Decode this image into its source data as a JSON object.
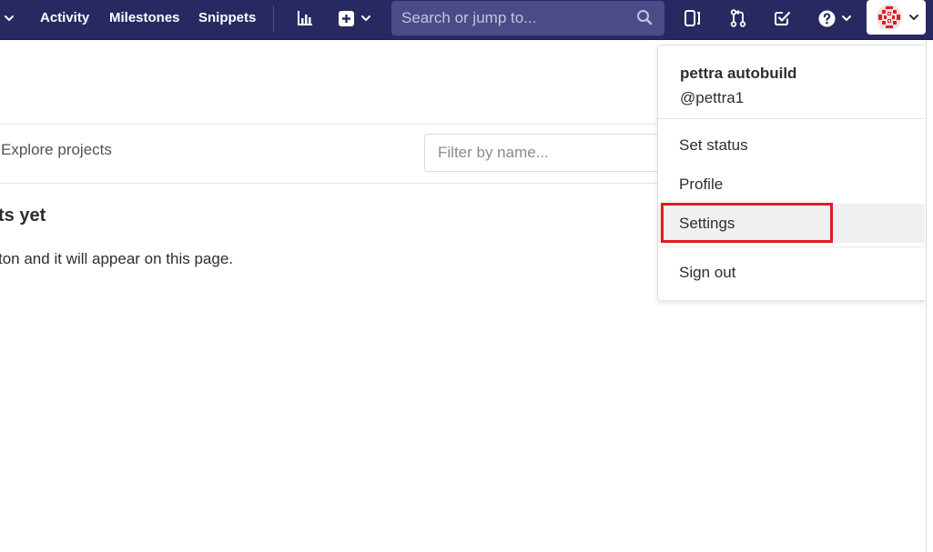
{
  "navbar": {
    "items": [
      {
        "label": "Activity"
      },
      {
        "label": "Milestones"
      },
      {
        "label": "Snippets"
      }
    ],
    "icons": {
      "chart": "chart-icon",
      "new": "plus-square-icon",
      "sidebar": "sidebar-toggle-icon",
      "merge_requests": "merge-request-icon",
      "todos": "todo-check-icon",
      "help": "help-icon"
    },
    "search": {
      "placeholder": "Search or jump to..."
    },
    "colors": {
      "bar": "#292961",
      "search_bg": "#4b4b88"
    }
  },
  "main": {
    "tab_label": "Explore projects",
    "filter": {
      "placeholder": "Filter by name..."
    },
    "empty": {
      "title": "ts yet",
      "text": "ton and it will appear on this page."
    }
  },
  "user_menu": {
    "name": "pettra autobuild",
    "handle": "@pettra1",
    "items": [
      {
        "label": "Set status"
      },
      {
        "label": "Profile"
      },
      {
        "label": "Settings"
      },
      {
        "label": "Sign out"
      }
    ],
    "highlight_color": "#e01c24"
  }
}
